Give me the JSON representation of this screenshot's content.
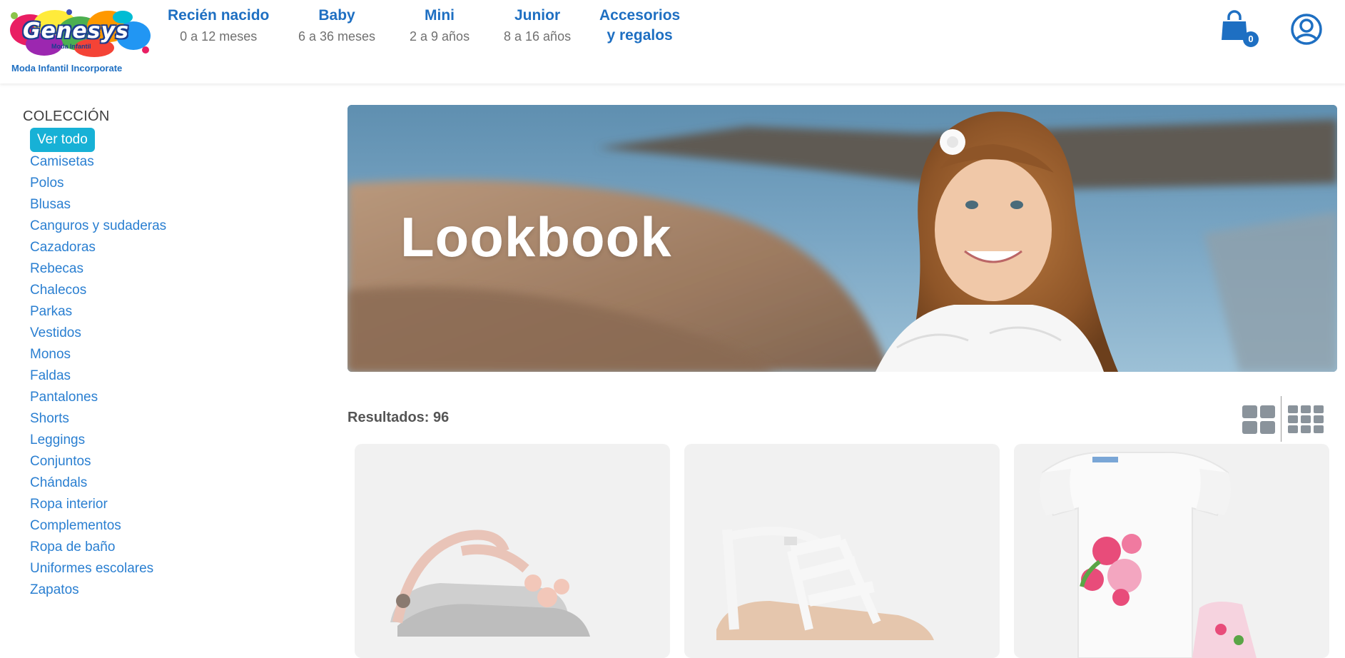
{
  "brand": {
    "logo_name": "Genesys",
    "logo_sub": "Moda Infantil",
    "tagline": "Moda Infantil Incorporate"
  },
  "nav": [
    {
      "title": "Recién nacido",
      "sub": "0 a 12 meses"
    },
    {
      "title": "Baby",
      "sub": "6 a 36 meses"
    },
    {
      "title": "Mini",
      "sub": "2 a 9 años"
    },
    {
      "title": "Junior",
      "sub": "8 a 16 años"
    },
    {
      "title": "Accesorios",
      "sub": "y regalos"
    }
  ],
  "cart": {
    "count": "0",
    "icon": "shopping-bag-icon"
  },
  "account": {
    "icon": "user-circle-icon"
  },
  "sidebar": {
    "title": "COLECCIÓN",
    "items": [
      "Ver todo",
      "Camisetas",
      "Polos",
      "Blusas",
      "Canguros y sudaderas",
      "Cazadoras",
      "Rebecas",
      "Chalecos",
      "Parkas",
      "Vestidos",
      "Monos",
      "Faldas",
      "Pantalones",
      "Shorts",
      "Leggings",
      "Conjuntos",
      "Chándals",
      "Ropa interior",
      "Complementos",
      "Ropa de baño",
      "Uniformes escolares",
      "Zapatos"
    ],
    "active_index": 0
  },
  "banner": {
    "title": "Lookbook"
  },
  "results": {
    "label": "Resultados: 96"
  },
  "view_toggles": {
    "grid2_icon": "grid-2-icon",
    "grid3_icon": "grid-3-icon"
  },
  "colors": {
    "primary_blue": "#1e6fc2",
    "link_blue": "#2a7fd1",
    "active_cyan": "#17b1d6",
    "muted_text": "#707070"
  }
}
